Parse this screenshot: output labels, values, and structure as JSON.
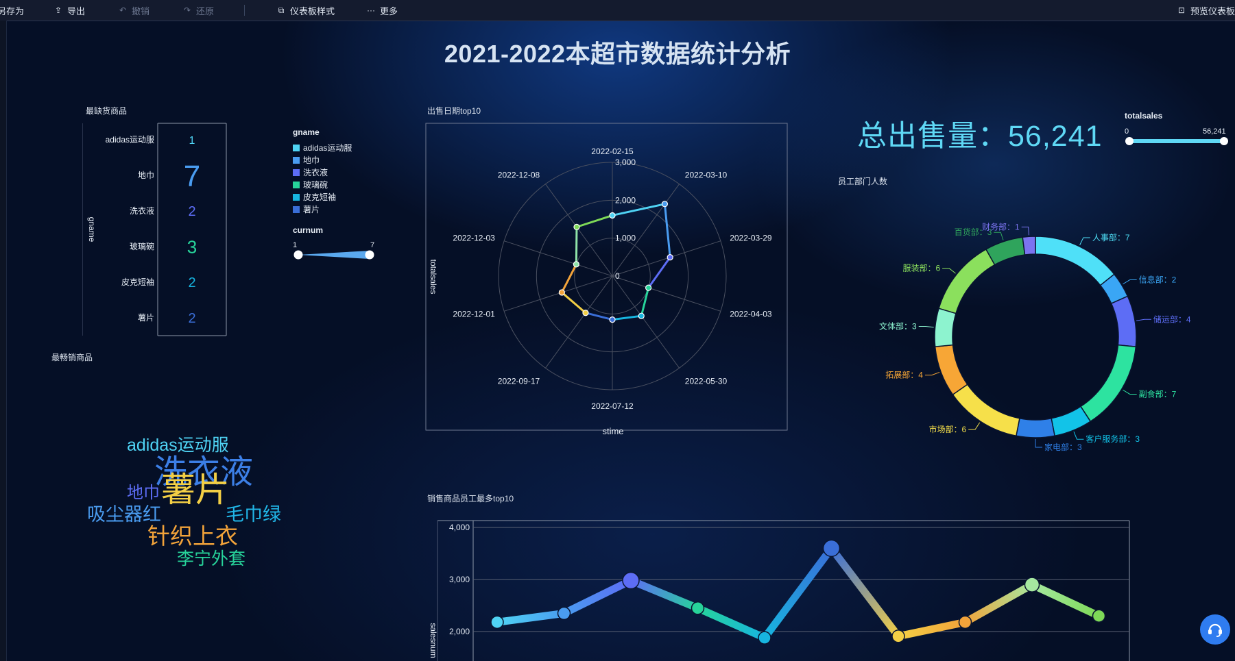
{
  "toolbar": {
    "save_as": "另存为",
    "export": "导出",
    "undo": "撤销",
    "redo": "还原",
    "dashboard_style": "仪表板样式",
    "more": "更多",
    "preview": "预览仪表板"
  },
  "dashboard_title": "2021-2022本超市数据统计分析",
  "panels": {
    "shortage": "最缺货商品",
    "bestseller": "最畅销商品",
    "date_top10": "出售日期top10",
    "dept_staff": "员工部门人数",
    "staff_top10": "销售商品员工最多top10"
  },
  "kpi": {
    "text": "总出售量：56,241"
  },
  "colors": {
    "accent": "#5fd8f5",
    "background": "#050f26",
    "axis": "#8d97a8"
  },
  "chart_data": [
    {
      "type": "table",
      "panel": "最缺货商品",
      "axis_label": "gname",
      "rows": [
        {
          "name": "adidas运动服",
          "value": 1,
          "color": "#4fd3f4",
          "size": 16
        },
        {
          "name": "地巾",
          "value": 7,
          "color": "#4a9cf0",
          "size": 44
        },
        {
          "name": "洗衣液",
          "value": 2,
          "color": "#5d6df5",
          "size": 20
        },
        {
          "name": "玻璃碗",
          "value": 3,
          "color": "#27d39a",
          "size": 26
        },
        {
          "name": "皮克短袖",
          "value": 2,
          "color": "#17b5e0",
          "size": 20
        },
        {
          "name": "薯片",
          "value": 2,
          "color": "#3a6ed8",
          "size": 20
        }
      ],
      "legend": {
        "title": "gname",
        "items": [
          {
            "name": "adidas运动服",
            "color": "#4fd3f4"
          },
          {
            "name": "地巾",
            "color": "#4a9cf0"
          },
          {
            "name": "洗衣液",
            "color": "#5d6df5"
          },
          {
            "name": "玻璃碗",
            "color": "#27d39a"
          },
          {
            "name": "皮克短袖",
            "color": "#17b5e0"
          },
          {
            "name": "薯片",
            "color": "#3a6ed8"
          }
        ]
      },
      "range": {
        "title": "curnum",
        "min": "1",
        "max": "7"
      }
    },
    {
      "type": "wordcloud",
      "panel": "最畅销商品",
      "words": [
        {
          "text": "adidas运动服",
          "color": "#4fd3f4",
          "size": 25
        },
        {
          "text": "洗衣液",
          "color": "#3c7fe6",
          "size": 48
        },
        {
          "text": "地巾",
          "color": "#5d6df5",
          "size": 24
        },
        {
          "text": "薯片",
          "color": "#f3cf45",
          "size": 50
        },
        {
          "text": "吸尘器红",
          "color": "#4a9cf0",
          "size": 27
        },
        {
          "text": "毛巾绿",
          "color": "#21b5e6",
          "size": 27
        },
        {
          "text": "针织上衣",
          "color": "#f2a33a",
          "size": 33
        },
        {
          "text": "李宁外套",
          "color": "#27d39a",
          "size": 25
        }
      ]
    },
    {
      "type": "radar",
      "panel": "出售日期top10",
      "xlabel": "stime",
      "ylabel": "totalsales",
      "rticks": [
        "0",
        "1,000",
        "2,000",
        "3,000"
      ],
      "rmax": 3000,
      "categories": [
        "2022-02-15",
        "2022-03-10",
        "2022-03-29",
        "2022-04-03",
        "2022-05-30",
        "2022-07-12",
        "2022-09-17",
        "2022-12-01",
        "2022-12-03",
        "2022-12-08"
      ],
      "values": [
        1600,
        2350,
        1600,
        1000,
        1300,
        1150,
        1200,
        1400,
        1000,
        1600
      ],
      "colors": [
        "#4fd3f4",
        "#4a9cf0",
        "#5d6df5",
        "#27d39a",
        "#17b5e0",
        "#3a6ed8",
        "#f3cf45",
        "#f2a33a",
        "#8fe3a8",
        "#7ed957"
      ]
    },
    {
      "type": "pie",
      "panel": "员工部门人数",
      "donut": true,
      "slices": [
        {
          "name": "人事部",
          "label": "人事部：7",
          "value": 7,
          "color": "#4fe0f8"
        },
        {
          "name": "信息部",
          "label": "信息部：2",
          "value": 2,
          "color": "#3aa6f5"
        },
        {
          "name": "储运部",
          "label": "储运部：4",
          "value": 4,
          "color": "#5d6df5"
        },
        {
          "name": "副食部",
          "label": "副食部：7",
          "value": 7,
          "color": "#2de3a0"
        },
        {
          "name": "客户服务部",
          "label": "客户服务部：3",
          "value": 3,
          "color": "#12c3e8"
        },
        {
          "name": "家电部",
          "label": "家电部：3",
          "value": 3,
          "color": "#2f80e8"
        },
        {
          "name": "市场部",
          "label": "市场部：6",
          "value": 6,
          "color": "#f6e04a"
        },
        {
          "name": "拓展部",
          "label": "拓展部：4",
          "value": 4,
          "color": "#f7a636"
        },
        {
          "name": "文体部",
          "label": "文体部：3",
          "value": 3,
          "color": "#8df3cf"
        },
        {
          "name": "服装部",
          "label": "服装部：6",
          "value": 6,
          "color": "#8be05d"
        },
        {
          "name": "百货部",
          "label": "百货部：3",
          "value": 3,
          "color": "#2fa45c"
        },
        {
          "name": "财务部",
          "label": "财务部：1",
          "value": 1,
          "color": "#7b74f0"
        }
      ],
      "range": {
        "title": "totalsales",
        "min": "0",
        "max": "56,241"
      }
    },
    {
      "type": "line",
      "panel": "销售商品员工最多top10",
      "ylabel": "salesnum",
      "yticks": [
        "2,000",
        "3,000",
        "4,000"
      ],
      "ylim": [
        1600,
        4000
      ],
      "values": [
        2180,
        2350,
        2980,
        2450,
        1880,
        3600,
        1910,
        2180,
        2900,
        2300
      ],
      "colors": [
        "#4fd3f4",
        "#4a9cf0",
        "#5d6df5",
        "#27d39a",
        "#17b5e0",
        "#3a6ed8",
        "#f3cf45",
        "#f2a33a",
        "#a6e8a0",
        "#7ed957"
      ]
    }
  ]
}
